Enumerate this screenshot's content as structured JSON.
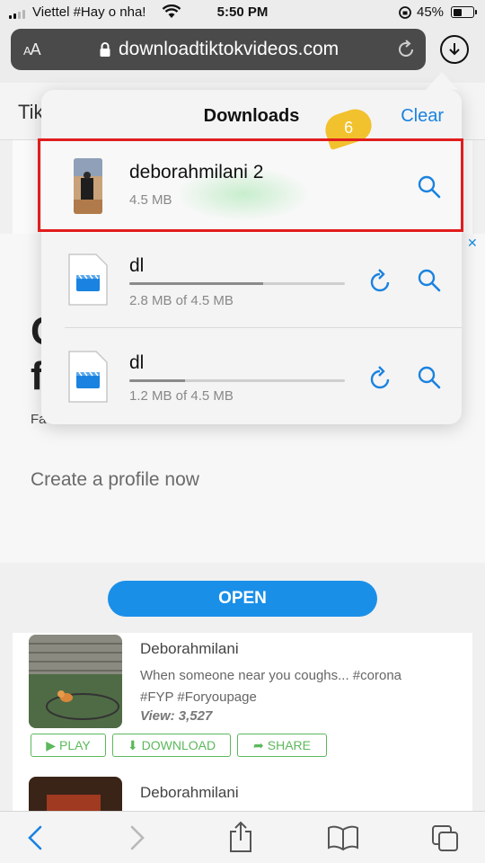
{
  "status_bar": {
    "carrier": "Viettel #Hay o nha!",
    "time": "5:50 PM",
    "battery": "45%",
    "battery_level": 0.45,
    "signal_bars": 2
  },
  "browser": {
    "text_size_label": "AA",
    "url": "downloadtiktokvideos.com",
    "lock_icon": "lock-icon",
    "reload_icon": "reload-icon",
    "downloads_icon": "download-circle-icon"
  },
  "page": {
    "header_text": "Tik",
    "big_letters": [
      "C",
      "f"
    ],
    "fa_text": "Fa",
    "create_profile": "Create a profile now",
    "open_button": "OPEN",
    "ad_close": "✕"
  },
  "videos": [
    {
      "author": "Deborahmilani",
      "description": "When someone near you coughs... #corona #FYP #Foryoupage",
      "views": "View: 3,527",
      "buttons": {
        "play": "PLAY",
        "download": "DOWNLOAD",
        "share": "SHARE"
      }
    },
    {
      "author": "Deborahmilani"
    }
  ],
  "downloads": {
    "title": "Downloads",
    "clear": "Clear",
    "badge": "6",
    "items": [
      {
        "name": "deborahmilani 2",
        "size": "4.5 MB",
        "progress": 1.0,
        "status": "complete"
      },
      {
        "name": "dl",
        "size": "2.8 MB of 4.5 MB",
        "progress": 0.62,
        "status": "in-progress"
      },
      {
        "name": "dl",
        "size": "1.2 MB of 4.5 MB",
        "progress": 0.26,
        "status": "in-progress"
      }
    ]
  },
  "colors": {
    "accent": "#1a82e0",
    "highlight": "#e11d1d",
    "badge": "#f2c12e",
    "open_button": "#1a8fe8",
    "action_green": "#5cb85c"
  },
  "toolbar": {
    "icons": [
      "back-icon",
      "forward-icon",
      "share-icon",
      "bookmarks-icon",
      "tabs-icon"
    ]
  }
}
